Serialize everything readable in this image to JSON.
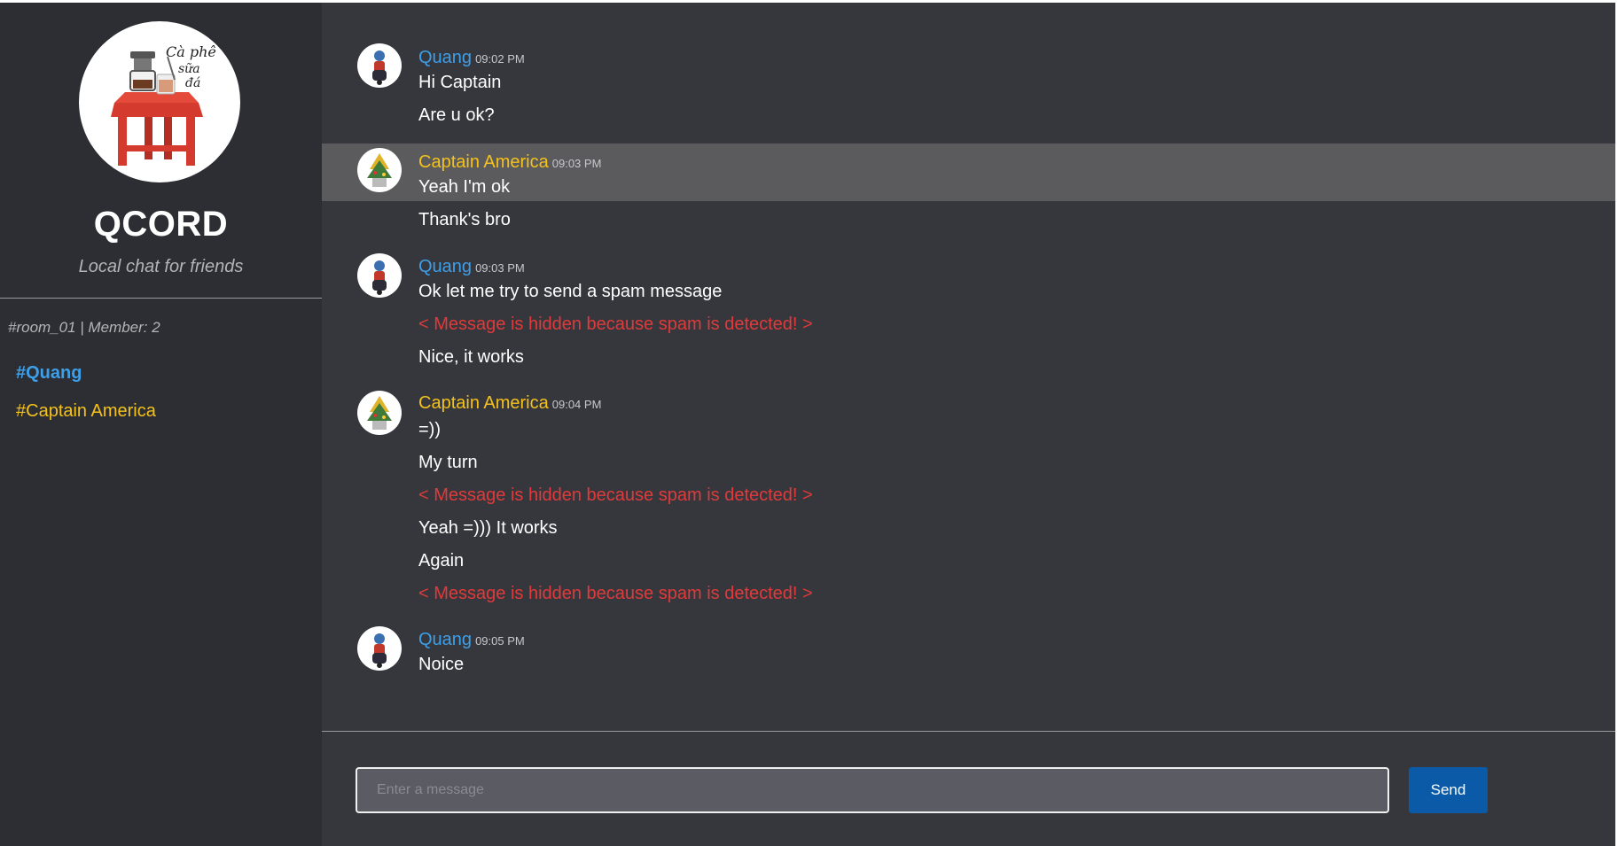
{
  "sidebar": {
    "logo_text": "Cà phê sữa đá",
    "title": "QCORD",
    "subtitle": "Local chat for friends",
    "room_info": "#room_01 | Member: 2",
    "members": [
      "#Quang",
      "#Captain America"
    ]
  },
  "colors": {
    "sidebar_bg": "#2d2e33",
    "main_bg": "#36373d",
    "quang": "#3d9fe8",
    "captain": "#f4c21a",
    "spam": "#e03a3a",
    "send_button": "#0a5aa8"
  },
  "messages": [
    {
      "author": "Quang",
      "time": "09:02 PM",
      "lines": [
        "Hi Captain",
        "Are u ok?"
      ]
    },
    {
      "author": "Captain America",
      "time": "09:03 PM",
      "lines": [
        "Yeah I'm ok",
        "Thank's bro"
      ]
    },
    {
      "author": "Quang",
      "time": "09:03 PM",
      "lines": [
        "Ok let me try to send a spam message",
        "< Message is hidden because spam is detected! >",
        "Nice, it works"
      ]
    },
    {
      "author": "Captain America",
      "time": "09:04 PM",
      "lines": [
        "=))",
        "My turn",
        "< Message is hidden because spam is detected! >",
        "Yeah =))) It works",
        "Again",
        "< Message is hidden because spam is detected! >"
      ]
    },
    {
      "author": "Quang",
      "time": "09:05 PM",
      "lines": [
        "Noice"
      ]
    }
  ],
  "composer": {
    "placeholder": "Enter a message",
    "send_label": "Send"
  }
}
